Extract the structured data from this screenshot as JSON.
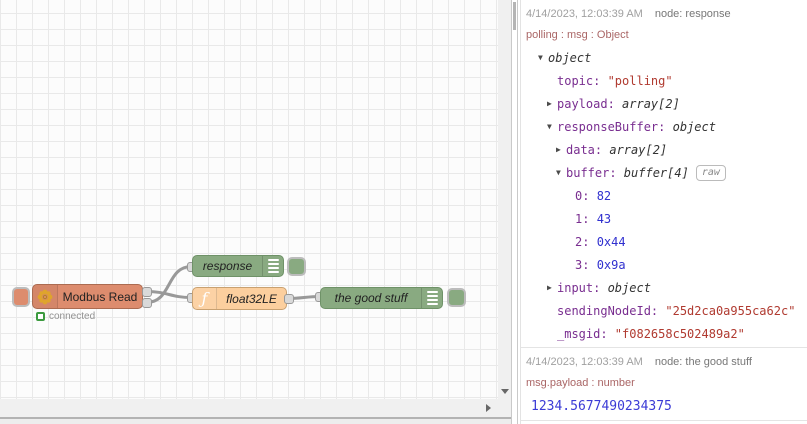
{
  "canvas": {
    "nodes": {
      "modbus": {
        "label": "Modbus Read",
        "status": "connected"
      },
      "response": {
        "label": "response"
      },
      "func": {
        "label": "float32LE",
        "icon_glyph": "ƒ"
      },
      "goodstuff": {
        "label": "the good stuff"
      }
    }
  },
  "debug": {
    "messages": [
      {
        "timestamp": "4/14/2023, 12:03:39 AM",
        "node": "node: response",
        "meta": "polling : msg : Object",
        "tree": [
          {
            "indent": 0,
            "arrow": "down",
            "key": null,
            "value": "object",
            "type": "type"
          },
          {
            "indent": 1,
            "arrow": null,
            "key": "topic",
            "value": "\"polling\"",
            "type": "string"
          },
          {
            "indent": 1,
            "arrow": "right",
            "key": "payload",
            "value": "array[2]",
            "type": "type"
          },
          {
            "indent": 1,
            "arrow": "down",
            "key": "responseBuffer",
            "value": "object",
            "type": "type"
          },
          {
            "indent": 2,
            "arrow": "right",
            "key": "data",
            "value": "array[2]",
            "type": "type"
          },
          {
            "indent": 2,
            "arrow": "down",
            "key": "buffer",
            "value": "buffer[4]",
            "type": "type",
            "badge": "raw"
          },
          {
            "indent": 3,
            "arrow": null,
            "key": "0",
            "value": "82",
            "type": "number"
          },
          {
            "indent": 3,
            "arrow": null,
            "key": "1",
            "value": "43",
            "type": "number"
          },
          {
            "indent": 3,
            "arrow": null,
            "key": "2",
            "value": "0x44",
            "type": "number"
          },
          {
            "indent": 3,
            "arrow": null,
            "key": "3",
            "value": "0x9a",
            "type": "number"
          },
          {
            "indent": 1,
            "arrow": "right",
            "key": "input",
            "value": "object",
            "type": "type"
          },
          {
            "indent": 1,
            "arrow": null,
            "key": "sendingNodeId",
            "value": "\"25d2ca0a955ca62c\"",
            "type": "string"
          },
          {
            "indent": 1,
            "arrow": null,
            "key": "_msgid",
            "value": "\"f082658c502489a2\"",
            "type": "string"
          }
        ]
      },
      {
        "timestamp": "4/14/2023, 12:03:39 AM",
        "node": "node: the good stuff",
        "meta": "msg.payload : number",
        "value": "1234.5677490234375"
      }
    ]
  },
  "colors": {
    "modbus_node": "#dd8c6e",
    "debug_node": "#89aa81",
    "function_node": "#fccf9e",
    "status_connected": "#3c9a3f",
    "wire": "#999999",
    "debug_key": "#792e90",
    "debug_string": "#b03a30",
    "debug_number": "#3030cf",
    "debug_topic": "#aa6666"
  }
}
